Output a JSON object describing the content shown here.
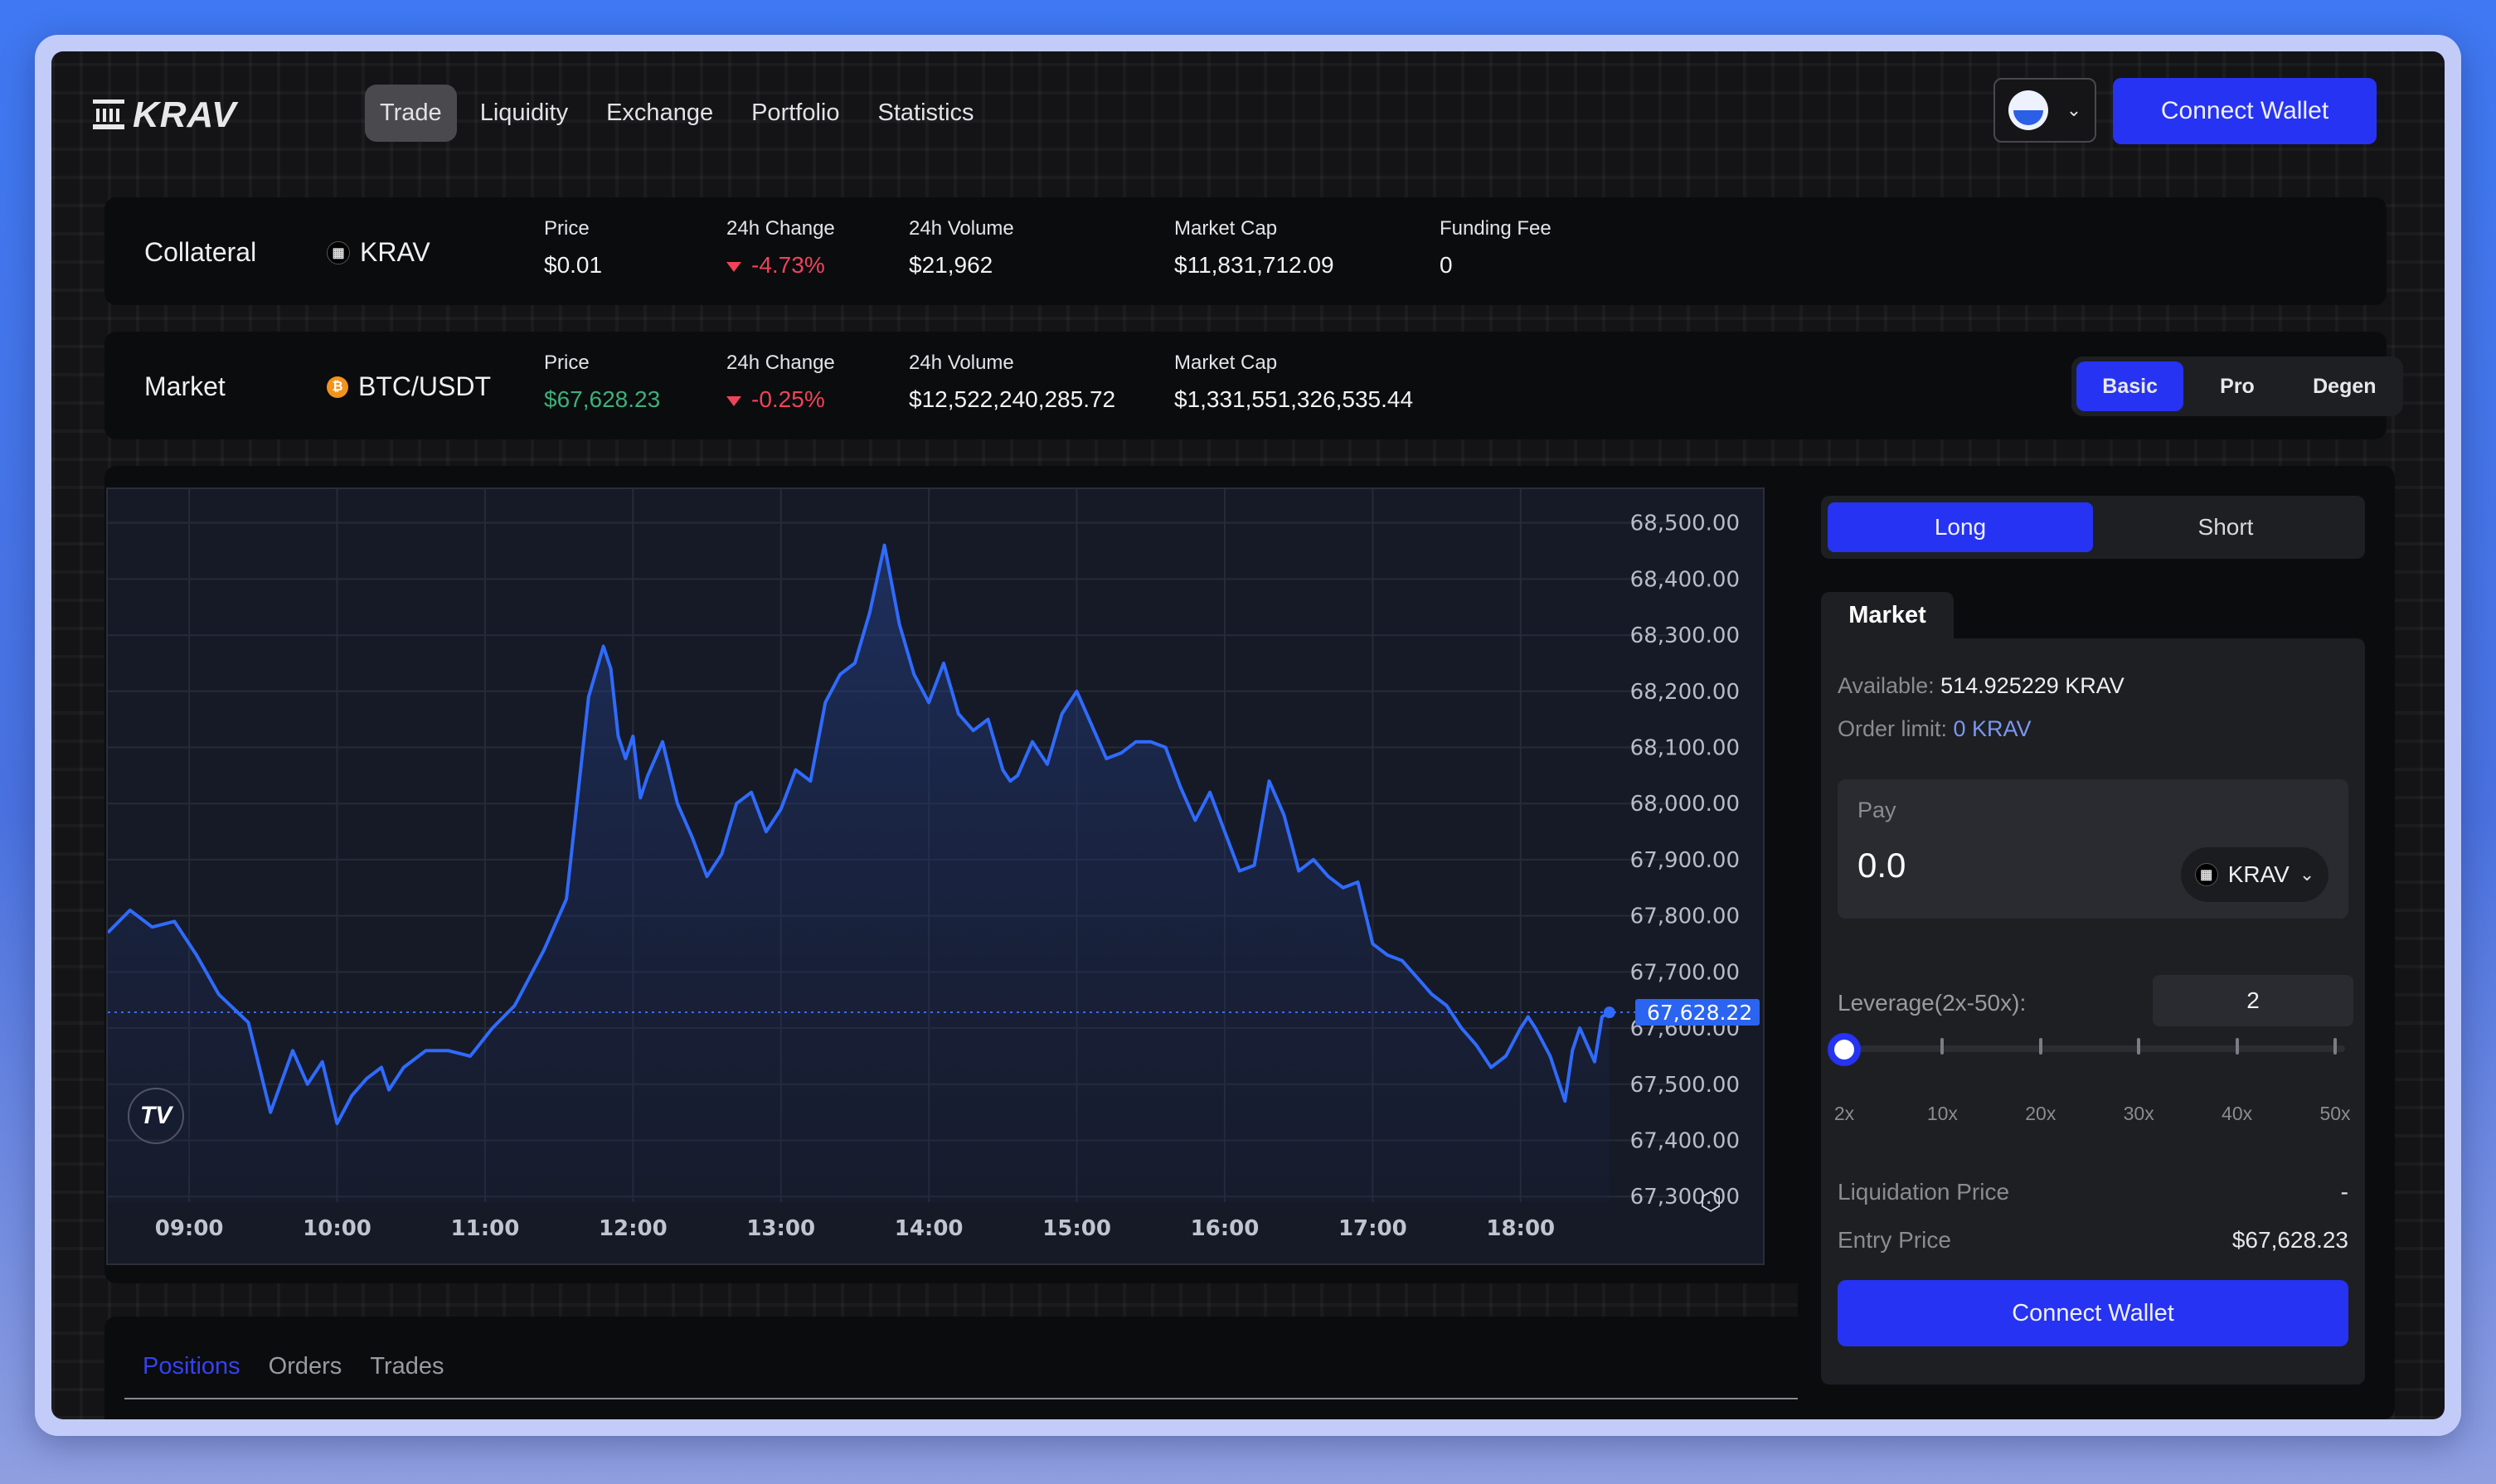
{
  "header": {
    "logo_text": "KRAV",
    "nav": [
      {
        "label": "Trade",
        "active": true
      },
      {
        "label": "Liquidity",
        "active": false
      },
      {
        "label": "Exchange",
        "active": false
      },
      {
        "label": "Portfolio",
        "active": false
      },
      {
        "label": "Statistics",
        "active": false
      }
    ],
    "network_icon": "network-globe-icon",
    "connect_wallet": "Connect Wallet"
  },
  "collateral": {
    "title": "Collateral",
    "asset": "KRAV",
    "stats": [
      {
        "label": "Price",
        "value": "$0.01"
      },
      {
        "label": "24h Change",
        "value": "-4.73%",
        "direction": "down"
      },
      {
        "label": "24h Volume",
        "value": "$21,962"
      },
      {
        "label": "Market Cap",
        "value": "$11,831,712.09"
      },
      {
        "label": "Funding Fee",
        "value": "0"
      }
    ]
  },
  "market": {
    "title": "Market",
    "asset": "BTC/USDT",
    "stats": [
      {
        "label": "Price",
        "value": "$67,628.23"
      },
      {
        "label": "24h Change",
        "value": "-0.25%",
        "direction": "down"
      },
      {
        "label": "24h Volume",
        "value": "$12,522,240,285.72"
      },
      {
        "label": "Market Cap",
        "value": "$1,331,551,326,535.44"
      }
    ],
    "modes": [
      "Basic",
      "Pro",
      "Degen"
    ],
    "active_mode": "Basic"
  },
  "chart_data": {
    "type": "area",
    "title": "",
    "xlabel": "",
    "ylabel": "",
    "x_ticks": [
      "09:00",
      "10:00",
      "11:00",
      "12:00",
      "13:00",
      "14:00",
      "15:00",
      "16:00",
      "17:00",
      "18:00"
    ],
    "y_ticks": [
      "68,500.00",
      "68,400.00",
      "68,300.00",
      "68,200.00",
      "68,100.00",
      "68,000.00",
      "67,900.00",
      "67,800.00",
      "67,700.00",
      "67,600.00",
      "67,500.00",
      "67,400.00",
      "67,300.00"
    ],
    "ylim": [
      67290,
      68560
    ],
    "xlim_hours": [
      8.45,
      19.1
    ],
    "current_price_label": "67,628.22",
    "current_price": 67628.22,
    "grid": true,
    "series": [
      {
        "name": "BTC/USDT",
        "color": "#2f6bff",
        "x_hours": [
          8.45,
          8.6,
          8.75,
          8.9,
          9.05,
          9.2,
          9.4,
          9.55,
          9.7,
          9.8,
          9.9,
          10.0,
          10.1,
          10.2,
          10.3,
          10.35,
          10.45,
          10.6,
          10.75,
          10.9,
          11.05,
          11.2,
          11.4,
          11.55,
          11.7,
          11.8,
          11.85,
          11.9,
          11.95,
          12.0,
          12.05,
          12.1,
          12.2,
          12.3,
          12.4,
          12.5,
          12.6,
          12.7,
          12.8,
          12.9,
          13.0,
          13.1,
          13.2,
          13.3,
          13.4,
          13.5,
          13.6,
          13.7,
          13.8,
          13.9,
          14.0,
          14.1,
          14.2,
          14.3,
          14.4,
          14.5,
          14.55,
          14.6,
          14.7,
          14.8,
          14.9,
          15.0,
          15.1,
          15.2,
          15.3,
          15.4,
          15.5,
          15.6,
          15.7,
          15.8,
          15.9,
          16.0,
          16.1,
          16.2,
          16.3,
          16.4,
          16.5,
          16.6,
          16.7,
          16.8,
          16.9,
          17.0,
          17.1,
          17.2,
          17.3,
          17.4,
          17.5,
          17.6,
          17.7,
          17.8,
          17.9,
          18.0,
          18.05,
          18.1,
          18.2,
          18.3,
          18.35,
          18.4,
          18.5,
          18.55,
          18.6
        ],
        "values": [
          67770,
          67810,
          67780,
          67790,
          67730,
          67660,
          67610,
          67450,
          67560,
          67500,
          67540,
          67430,
          67480,
          67510,
          67530,
          67490,
          67530,
          67560,
          67560,
          67550,
          67600,
          67640,
          67740,
          67830,
          68190,
          68280,
          68240,
          68120,
          68080,
          68120,
          68010,
          68050,
          68110,
          68000,
          67940,
          67870,
          67910,
          68000,
          68020,
          67950,
          67990,
          68060,
          68040,
          68180,
          68230,
          68250,
          68340,
          68460,
          68320,
          68230,
          68180,
          68250,
          68160,
          68130,
          68150,
          68060,
          68040,
          68050,
          68110,
          68070,
          68160,
          68200,
          68140,
          68080,
          68090,
          68110,
          68110,
          68100,
          68030,
          67970,
          68020,
          67950,
          67880,
          67890,
          68040,
          67980,
          67880,
          67900,
          67870,
          67850,
          67860,
          67750,
          67730,
          67720,
          67690,
          67660,
          67640,
          67600,
          67570,
          67530,
          67550,
          67600,
          67620,
          67600,
          67550,
          67470,
          67560,
          67600,
          67540,
          67620,
          67628
        ]
      }
    ]
  },
  "chart_controls": {
    "tv_logo": "TV",
    "settings_icon": "settings-hexagon-icon"
  },
  "bottom_tabs": [
    {
      "label": "Positions",
      "active": true
    },
    {
      "label": "Orders",
      "active": false
    },
    {
      "label": "Trades",
      "active": false
    }
  ],
  "order_panel": {
    "sides": [
      "Long",
      "Short"
    ],
    "active_side": "Long",
    "order_type_tab": "Market",
    "available_label": "Available:",
    "available_value": "514.925229 KRAV",
    "order_limit_label": "Order limit:",
    "order_limit_value": "0 KRAV",
    "pay_label": "Pay",
    "pay_value": "0.0",
    "pay_token": "KRAV",
    "leverage_label": "Leverage(2x-50x):",
    "leverage_value": "2",
    "leverage_min": 2,
    "leverage_max": 50,
    "leverage_ticks": [
      "2x",
      "10x",
      "20x",
      "30x",
      "40x",
      "50x"
    ],
    "liquidation_label": "Liquidation Price",
    "liquidation_value": "-",
    "entry_label": "Entry Price",
    "entry_value": "$67,628.23",
    "connect_wallet": "Connect Wallet"
  },
  "colors": {
    "accent": "#2633f2",
    "chart_line": "#2f6bff",
    "negative": "#f0435a",
    "positive": "#3cb07a"
  }
}
